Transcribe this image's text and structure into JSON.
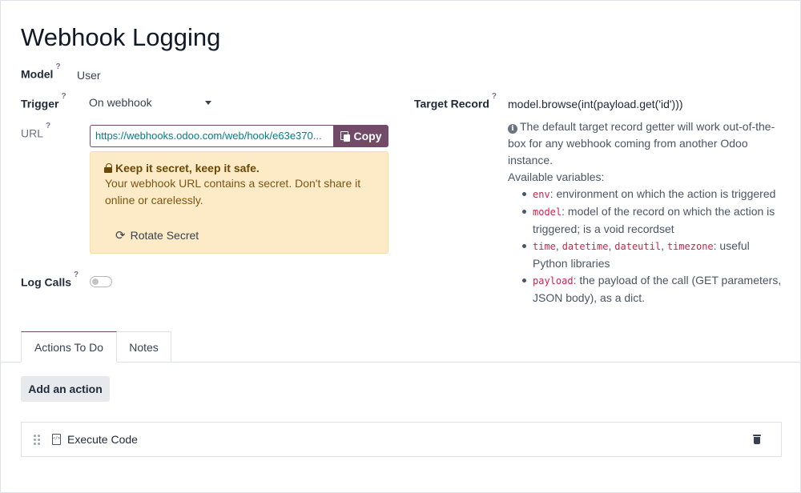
{
  "form": {
    "title": "Webhook Logging",
    "model_label": "Model",
    "model_value": "User",
    "trigger_label": "Trigger",
    "trigger_value": "On webhook",
    "url_label": "URL",
    "url_value": "https://webhooks.odoo.com/web/hook/e63e370...",
    "copy_label": "Copy",
    "log_calls_label": "Log Calls",
    "log_calls_enabled": false,
    "target_record_label": "Target Record",
    "target_record_value": "model.browse(int(payload.get('id')))",
    "help_mark": "?"
  },
  "alert": {
    "title": "Keep it secret, keep it safe.",
    "body": "Your webhook URL contains a secret. Don't share it online or carelessly.",
    "rotate_label": "Rotate Secret"
  },
  "help": {
    "intro": "The default target record getter will work out-of-the-box for any webhook coming from another Odoo instance.",
    "vars_title": "Available variables:",
    "vars": [
      {
        "codes": [
          "env"
        ],
        "text": ": environment on which the action is triggered"
      },
      {
        "codes": [
          "model"
        ],
        "text": ": model of the record on which the action is triggered; is a void recordset"
      },
      {
        "codes": [
          "time",
          "datetime",
          "dateutil",
          "timezone"
        ],
        "text": ": useful Python libraries"
      },
      {
        "codes": [
          "payload"
        ],
        "text": ": the payload of the call (GET parameters, JSON body), as a dict."
      }
    ]
  },
  "tabs": [
    {
      "label": "Actions To Do",
      "active": true
    },
    {
      "label": "Notes",
      "active": false
    }
  ],
  "actions": {
    "add_label": "Add an action",
    "items": [
      {
        "name": "Execute Code"
      }
    ]
  },
  "colors": {
    "primary": "#714b67",
    "warning_bg": "#fdebc8",
    "code": "#c7254e",
    "link": "#017e84"
  },
  "icons": {
    "copy": "copy-icon",
    "lock": "lock-icon",
    "rotate": "refresh-icon",
    "info": "info-circle-icon",
    "drag": "drag-handle-icon",
    "action_type": "file-code-icon",
    "delete": "trash-icon"
  }
}
